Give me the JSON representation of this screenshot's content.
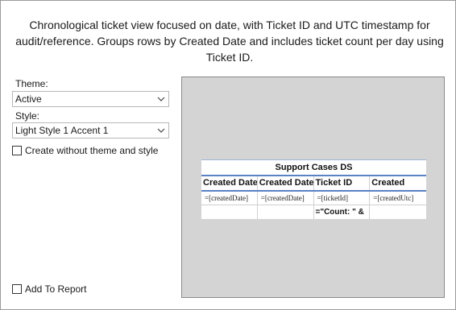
{
  "description": "Chronological ticket view focused on date, with Ticket ID and UTC timestamp for audit/reference. Groups rows by Created Date and includes ticket count per day using Ticket ID.",
  "theme": {
    "label": "Theme:",
    "value": "Active"
  },
  "style": {
    "label": "Style:",
    "value": "Light Style 1 Accent 1"
  },
  "create_without_theme": {
    "label": "Create without theme and style",
    "checked": false
  },
  "add_to_report": {
    "label": "Add To Report",
    "checked": false
  },
  "preview": {
    "title": "Support Cases DS",
    "headers": [
      "Created Date",
      "Created Date",
      "Ticket ID",
      "Created"
    ],
    "details": [
      "=[createdDate]",
      "=[createdDate]",
      "=[ticketId]",
      "=[createdUtc]"
    ],
    "footer": [
      "",
      "",
      "=\"Count: \" &",
      ""
    ]
  }
}
